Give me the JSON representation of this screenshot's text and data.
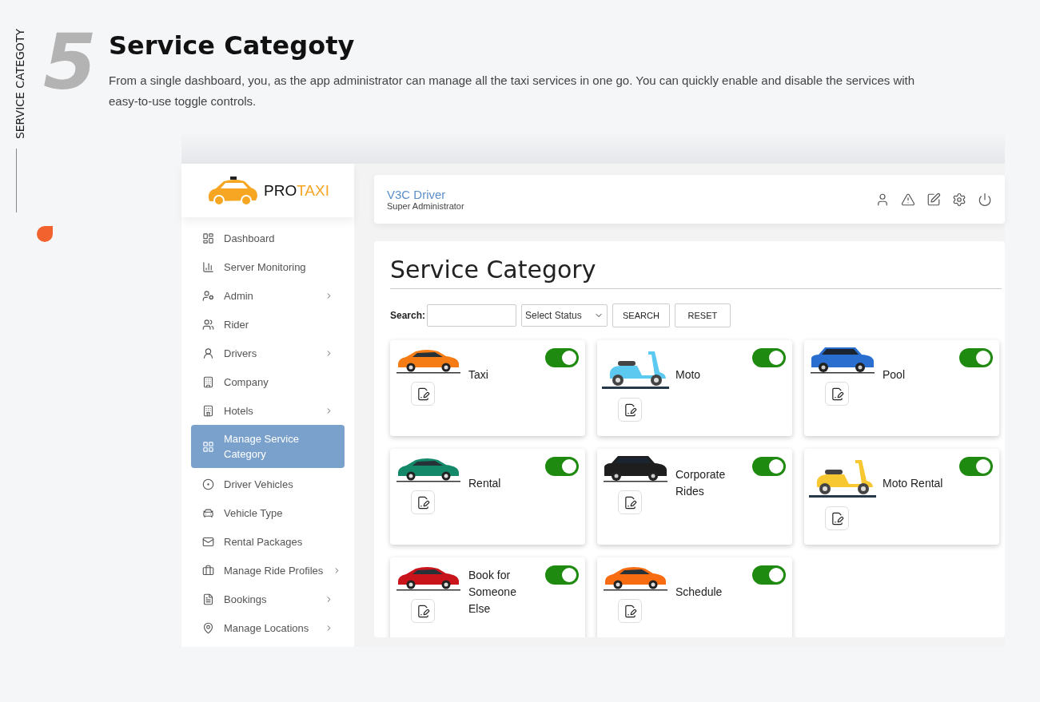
{
  "section": {
    "side_label": "SERVICE CATEGOTY",
    "number": "5",
    "title": "Service Categoty",
    "description": "From a single dashboard, you, as the app administrator can manage all the taxi services in one go. You can quickly enable and disable the services with easy-to-use toggle controls."
  },
  "app": {
    "logo": {
      "text_dark": "PRO",
      "text_accent": "TAXI"
    },
    "sidebar": [
      {
        "label": "Dashboard",
        "selected": false,
        "submenu": false
      },
      {
        "label": "Server Monitoring",
        "selected": false,
        "submenu": false
      },
      {
        "label": "Admin",
        "selected": false,
        "submenu": true
      },
      {
        "label": "Rider",
        "selected": false,
        "submenu": false
      },
      {
        "label": "Drivers",
        "selected": false,
        "submenu": true
      },
      {
        "label": "Company",
        "selected": false,
        "submenu": false
      },
      {
        "label": "Hotels",
        "selected": false,
        "submenu": true
      },
      {
        "label": "Manage Service Category",
        "selected": true,
        "submenu": false
      },
      {
        "label": "Driver Vehicles",
        "selected": false,
        "submenu": false
      },
      {
        "label": "Vehicle Type",
        "selected": false,
        "submenu": false
      },
      {
        "label": "Rental Packages",
        "selected": false,
        "submenu": false
      },
      {
        "label": "Manage Ride Profiles",
        "selected": false,
        "submenu": true
      },
      {
        "label": "Bookings",
        "selected": false,
        "submenu": true
      },
      {
        "label": "Manage Locations",
        "selected": false,
        "submenu": true
      }
    ],
    "user": {
      "name": "V3C Driver",
      "role": "Super Administrator"
    },
    "page_title": "Service Category",
    "search": {
      "label": "Search:",
      "status_placeholder": "Select Status",
      "buttons": [
        "SEARCH",
        "RESET"
      ]
    },
    "categories": [
      {
        "name": "Taxi",
        "on": true,
        "vehicle": {
          "kind": "car",
          "color": "#f57c14"
        }
      },
      {
        "name": "Moto",
        "on": true,
        "vehicle": {
          "kind": "scooter",
          "color": "#5ccaf0"
        }
      },
      {
        "name": "Pool",
        "on": true,
        "vehicle": {
          "kind": "suv",
          "color": "#2a6fd0"
        }
      },
      {
        "name": "Rental",
        "on": true,
        "vehicle": {
          "kind": "car",
          "color": "#13896a"
        }
      },
      {
        "name": "Corporate Rides",
        "on": true,
        "vehicle": {
          "kind": "suv",
          "color": "#1e1e1e"
        }
      },
      {
        "name": "Moto Rental",
        "on": true,
        "vehicle": {
          "kind": "scooter",
          "color": "#f7c832"
        }
      },
      {
        "name": "Book for Someone Else",
        "on": true,
        "vehicle": {
          "kind": "car",
          "color": "#c8141a"
        }
      },
      {
        "name": "Schedule",
        "on": true,
        "vehicle": {
          "kind": "car",
          "color": "#f76c10"
        }
      }
    ]
  }
}
